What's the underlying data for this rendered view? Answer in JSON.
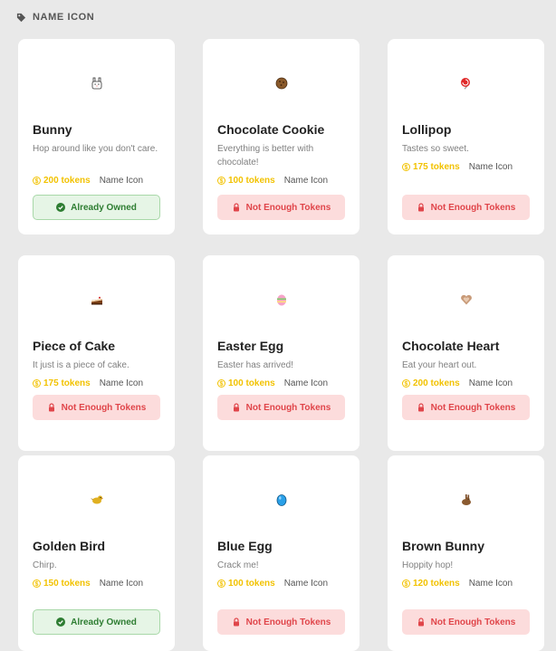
{
  "section": {
    "title": "NAME ICON",
    "icon": "tag-icon"
  },
  "colors": {
    "token": "#f2c200",
    "owned_bg": "#e6f5e6",
    "owned_text": "#2e7d32",
    "locked_bg": "#fcdcdc",
    "locked_text": "#e0454a"
  },
  "items": [
    {
      "name": "Bunny",
      "description": "Hop around like you don't care.",
      "price": "200 tokens",
      "type": "Name Icon",
      "status": "Already Owned",
      "owned": true,
      "icon": "bunny-icon"
    },
    {
      "name": "Chocolate Cookie",
      "description": "Everything is better with chocolate!",
      "price": "100 tokens",
      "type": "Name Icon",
      "status": "Not Enough Tokens",
      "owned": false,
      "icon": "cookie-icon"
    },
    {
      "name": "Lollipop",
      "description": "Tastes so sweet.",
      "price": "175 tokens",
      "type": "Name Icon",
      "status": "Not Enough Tokens",
      "owned": false,
      "icon": "lollipop-icon"
    },
    {
      "name": "Piece of Cake",
      "description": "It just is a piece of cake.",
      "price": "175 tokens",
      "type": "Name Icon",
      "status": "Not Enough Tokens",
      "owned": false,
      "icon": "cake-icon"
    },
    {
      "name": "Easter Egg",
      "description": "Easter has arrived!",
      "price": "100 tokens",
      "type": "Name Icon",
      "status": "Not Enough Tokens",
      "owned": false,
      "icon": "easter-egg-icon"
    },
    {
      "name": "Chocolate Heart",
      "description": "Eat your heart out.",
      "price": "200 tokens",
      "type": "Name Icon",
      "status": "Not Enough Tokens",
      "owned": false,
      "icon": "chocolate-heart-icon"
    },
    {
      "name": "Golden Bird",
      "description": "Chirp.",
      "price": "150 tokens",
      "type": "Name Icon",
      "status": "Already Owned",
      "owned": true,
      "icon": "golden-bird-icon"
    },
    {
      "name": "Blue Egg",
      "description": "Crack me!",
      "price": "100 tokens",
      "type": "Name Icon",
      "status": "Not Enough Tokens",
      "owned": false,
      "icon": "blue-egg-icon"
    },
    {
      "name": "Brown Bunny",
      "description": "Hoppity hop!",
      "price": "120 tokens",
      "type": "Name Icon",
      "status": "Not Enough Tokens",
      "owned": false,
      "icon": "brown-bunny-icon"
    }
  ]
}
